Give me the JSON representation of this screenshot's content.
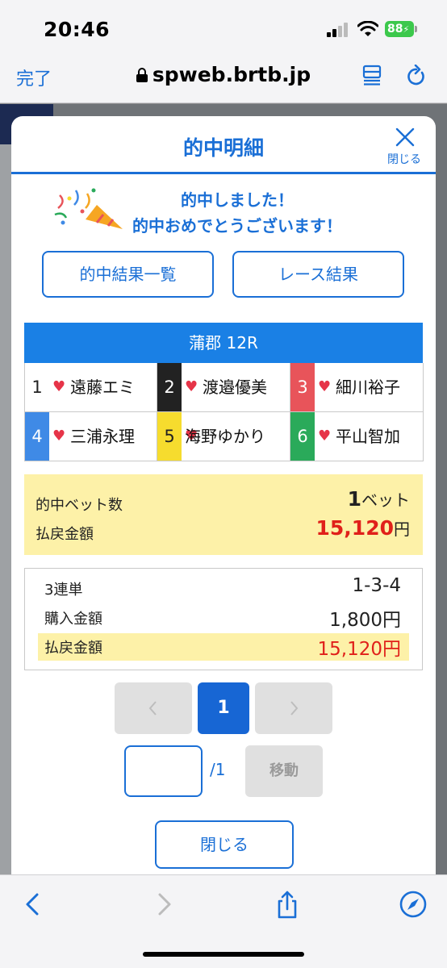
{
  "status_bar": {
    "time": "20:46",
    "battery": "88"
  },
  "browser": {
    "done_label": "完了",
    "url": "spweb.brtb.jp"
  },
  "modal": {
    "title": "的中明細",
    "close_label": "閉じる",
    "congrats_line1": "的中しました！",
    "congrats_line2": "的中おめでとうございます！",
    "results_list_button": "的中結果一覧",
    "race_results_button": "レース結果",
    "race_title": "蒲郡 12R",
    "players": [
      {
        "num": "1",
        "name": "遠藤エミ",
        "color": "#ffffff",
        "text_color": "#222222"
      },
      {
        "num": "2",
        "name": "渡邉優美",
        "color": "#222222",
        "text_color": "#ffffff"
      },
      {
        "num": "3",
        "name": "細川裕子",
        "color": "#e8545a",
        "text_color": "#ffffff"
      },
      {
        "num": "4",
        "name": "三浦永理",
        "color": "#3f8ae6",
        "text_color": "#ffffff"
      },
      {
        "num": "5",
        "name": "海野ゆかり",
        "color": "#f6dc2e",
        "text_color": "#222222"
      },
      {
        "num": "6",
        "name": "平山智加",
        "color": "#2aaa5a",
        "text_color": "#ffffff"
      }
    ],
    "summary": {
      "bet_count_label": "的中ベット数",
      "bet_count_value": "1",
      "bet_count_unit": "ベット",
      "payout_label": "払戻金額",
      "payout_value": "15,120",
      "payout_unit": "円"
    },
    "detail": {
      "bet_type_label": "3連単",
      "bet_type_value": "1-3-4",
      "purchase_label": "購入金額",
      "purchase_value": "1,800円",
      "payout_label": "払戻金額",
      "payout_value": "15,120円"
    },
    "pagination": {
      "current_page": "1",
      "total_pages": "/1",
      "go_label": "移動",
      "input_value": ""
    },
    "close_button": "閉じる"
  },
  "colors": {
    "accent": "#1a6fd6",
    "payout_red": "#e0201a",
    "highlight": "#fdf1a8"
  }
}
